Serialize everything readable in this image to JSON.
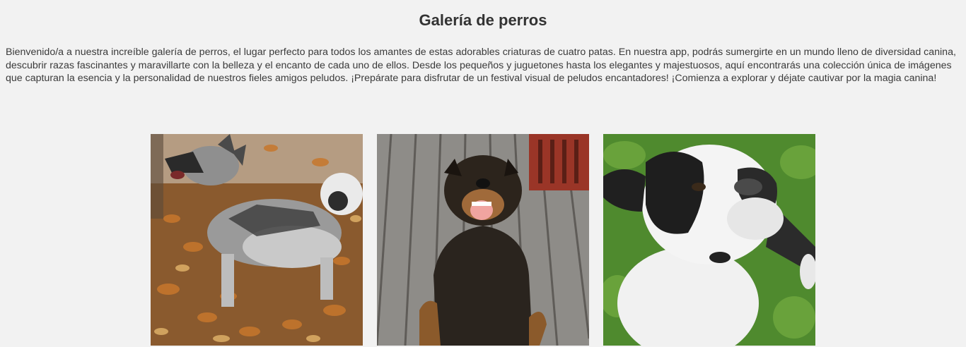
{
  "page": {
    "title": "Galería de perros",
    "intro": "Bienvenido/a a nuestra increíble galería de perros, el lugar perfecto para todos los amantes de estas adorables criaturas de cuatro patas. En nuestra app, podrás sumergirte en un mundo lleno de diversidad canina, descubrir razas fascinantes y maravillarte con la belleza y el encanto de cada uno de ellos. Desde los pequeños y juguetones hasta los elegantes y majestuosos, aquí encontrarás una colección única de imágenes que capturan la esencia y la personalidad de nuestros fieles amigos peludos. ¡Prepárate para disfrutar de un festival visual de peludos encantadores! ¡Comienza a explorar y déjate cautivar por la magia canina!"
  },
  "gallery": {
    "photos": [
      {
        "subject": "grey-dog-autumn-leaves"
      },
      {
        "subject": "black-tan-dog-wooden-deck"
      },
      {
        "subject": "white-black-dog-grass"
      }
    ]
  },
  "colors": {
    "background": "#f2f2f2",
    "text": "#333333"
  }
}
